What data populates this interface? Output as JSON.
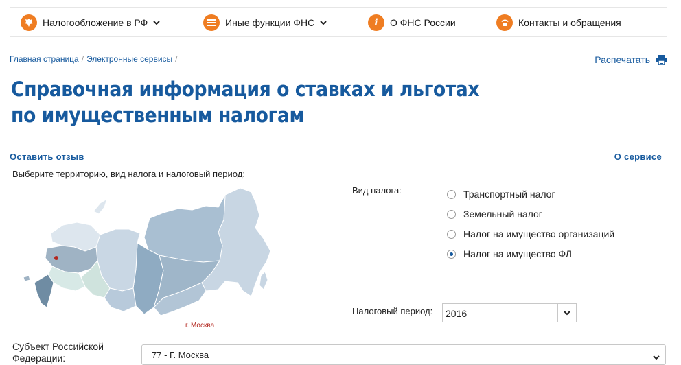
{
  "topnav": {
    "items": [
      {
        "label": "Налогообложение в РФ",
        "icon": "coat-of-arms-icon",
        "has_caret": true
      },
      {
        "label": "Иные функции ФНС",
        "icon": "menu-icon",
        "has_caret": true
      },
      {
        "label": "О ФНС России",
        "icon": "info-icon",
        "has_caret": false
      },
      {
        "label": "Контакты и обращения",
        "icon": "phone-icon",
        "has_caret": false
      }
    ]
  },
  "breadcrumb": {
    "items": [
      "Главная страница",
      "Электронные сервисы"
    ]
  },
  "print_label": "Распечатать",
  "page_title": "Справочная информация о ставках и льготах по имущественным налогам",
  "feedback_link": "Оставить отзыв",
  "about_link": "О сервисе",
  "instruction": "Выберите территорию, вид налога и налоговый период:",
  "map": {
    "caption": "г. Москва",
    "highlight_color": "#b3261e"
  },
  "tax_type": {
    "label": "Вид налога:",
    "options": [
      {
        "label": "Транспортный налог",
        "selected": false
      },
      {
        "label": "Земельный налог",
        "selected": false
      },
      {
        "label": "Налог на имущество организаций",
        "selected": false
      },
      {
        "label": "Налог на имущество ФЛ",
        "selected": true
      }
    ]
  },
  "period": {
    "label": "Налоговый период:",
    "value": "2016"
  },
  "subject": {
    "label": "Субъект Российской Федерации:",
    "value": "77 - Г. Москва"
  },
  "colors": {
    "brand_blue": "#175a9e",
    "accent_orange": "#ef7d22"
  }
}
